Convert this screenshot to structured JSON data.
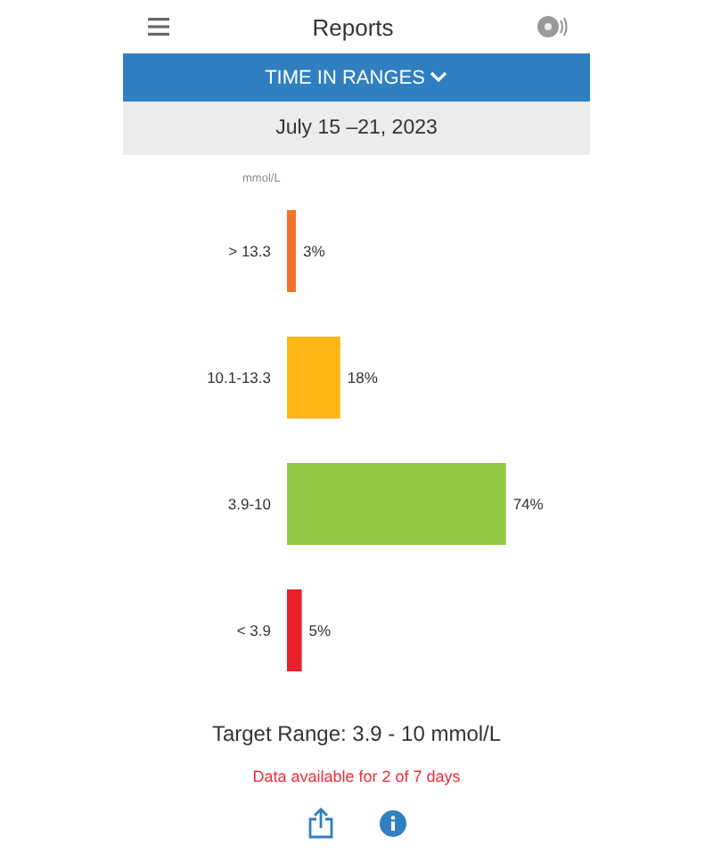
{
  "header": {
    "title": "Reports"
  },
  "report_selector": {
    "label": "TIME IN RANGES"
  },
  "date_range": "July 15 –21, 2023",
  "chart": {
    "unit": "mmol/L",
    "chart_data": {
      "type": "bar",
      "orientation": "horizontal",
      "data_labels": "value_labels",
      "value_labels": [
        "3%",
        "18%",
        "74%",
        "5%"
      ],
      "categories": [
        "> 13.3",
        "10.1-13.3",
        "3.9-10",
        "< 3.9"
      ],
      "values": [
        3,
        18,
        74,
        5
      ],
      "colors": [
        "#f07228",
        "#fdb714",
        "#93c843",
        "#e8212b"
      ]
    }
  },
  "target_range": "Target Range: 3.9 - 10 mmol/L",
  "availability": "Data available for 2 of 7 days"
}
